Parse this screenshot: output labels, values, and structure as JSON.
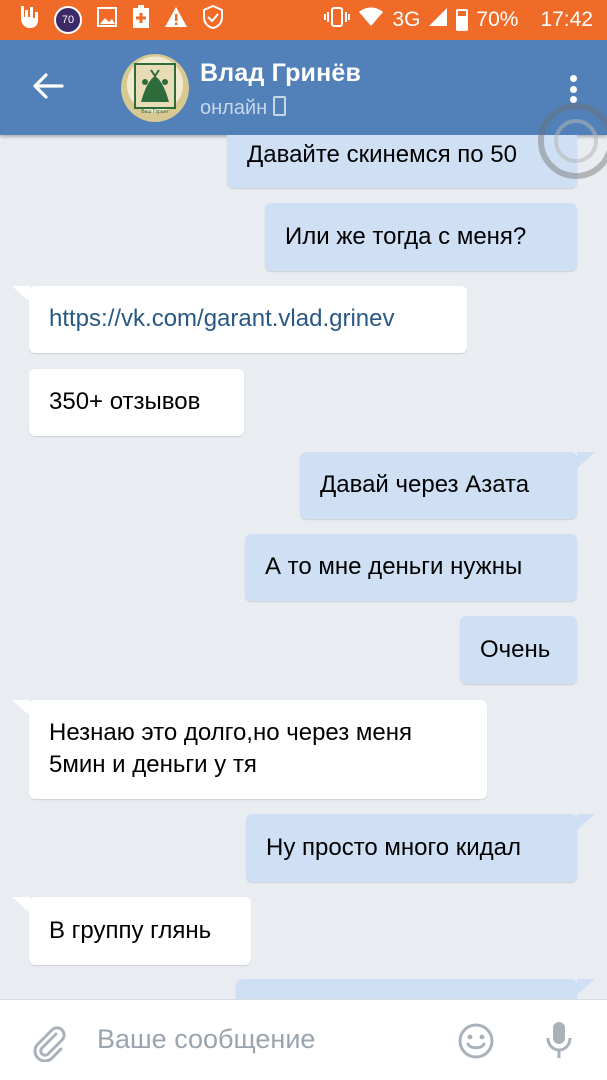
{
  "status_bar": {
    "badge": "70",
    "network": "3G",
    "battery": "70%",
    "battery_level": 0.7,
    "time": "17:42",
    "icons": [
      "hand-horns-icon",
      "badge-icon",
      "image-icon",
      "plus-box-icon",
      "warning-icon",
      "shield-check-icon",
      "vibrate-icon",
      "wifi-icon",
      "signal-icon",
      "battery-icon"
    ]
  },
  "header": {
    "name": "Влад Гринёв",
    "status": "онлайн",
    "avatar_caption": "Ваш Гарант",
    "icons": [
      "back-arrow-icon",
      "mobile-phone-icon",
      "more-vert-icon"
    ]
  },
  "messages": [
    {
      "dir": "out",
      "text": "Давайте скинемся по 50"
    },
    {
      "dir": "out",
      "text": "Или же тогда с меня?"
    },
    {
      "dir": "in",
      "text": "https://vk.com/garant.vlad.grinev",
      "link": true
    },
    {
      "dir": "in",
      "text": "350+ отзывов"
    },
    {
      "dir": "out",
      "text": "Давай через Азата"
    },
    {
      "dir": "out",
      "text": "А то мне деньги нужны"
    },
    {
      "dir": "out",
      "text": "Очень"
    },
    {
      "dir": "in",
      "lines": [
        "Незнаю это долго,но через меня",
        "5мин и деньги у тя"
      ]
    },
    {
      "dir": "out",
      "text": "Ну просто много кидал"
    },
    {
      "dir": "in",
      "text": "В группу глянь"
    }
  ],
  "composer": {
    "placeholder": "Ваше сообщение",
    "icons": [
      "paperclip-icon",
      "emoji-icon",
      "microphone-icon"
    ]
  },
  "colors": {
    "status_bar": "#f16b28",
    "header": "#5181b8",
    "background": "#e9edf1",
    "outgoing_bubble": "#cfe0f5",
    "incoming_bubble": "#ffffff",
    "link": "#2a5885"
  }
}
